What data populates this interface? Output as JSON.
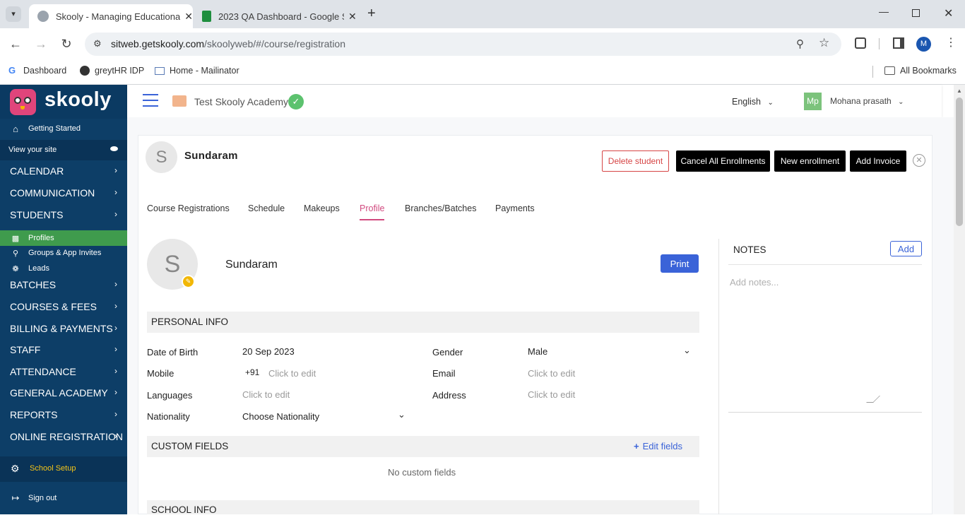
{
  "browser": {
    "tabs": [
      {
        "title": "Skooly - Managing Educational",
        "active": true
      },
      {
        "title": "2023 QA Dashboard - Google S",
        "active": false
      }
    ],
    "url_host": "sitweb.getskooly.com",
    "url_path": "/skoolyweb/#/course/registration",
    "bookmarks": [
      "Dashboard",
      "greytHR IDP",
      "Home - Mailinator"
    ],
    "all_bookmarks": "All Bookmarks",
    "profile_initial": "M"
  },
  "sidebar": {
    "logo_text": "skooly",
    "getting_started": "Getting Started",
    "view_site": "View your site",
    "menu": [
      {
        "label": "CALENDAR"
      },
      {
        "label": "COMMUNICATION"
      },
      {
        "label": "STUDENTS"
      }
    ],
    "students_sub": [
      {
        "label": "Profiles"
      },
      {
        "label": "Groups & App Invites"
      },
      {
        "label": "Leads"
      }
    ],
    "menu2": [
      {
        "label": "BATCHES"
      },
      {
        "label": "COURSES & FEES"
      },
      {
        "label": "BILLING & PAYMENTS"
      },
      {
        "label": "STAFF"
      },
      {
        "label": "ATTENDANCE"
      },
      {
        "label": "GENERAL ACADEMY"
      },
      {
        "label": "REPORTS"
      },
      {
        "label": "ONLINE REGISTRATION"
      }
    ],
    "school_setup": "School Setup",
    "sign_out": "Sign out"
  },
  "header": {
    "school_name": "Test Skooly Academy",
    "language": "English",
    "user_initials": "Mp",
    "user_name": "Mohana prasath"
  },
  "student": {
    "initial": "S",
    "name": "Sundaram"
  },
  "actions": {
    "delete": "Delete student",
    "cancel_all": "Cancel All Enrollments",
    "new_enrollment": "New enrollment",
    "add_invoice": "Add Invoice"
  },
  "tabs": [
    "Course Registrations",
    "Schedule",
    "Makeups",
    "Profile",
    "Branches/Batches",
    "Payments"
  ],
  "active_tab": "Profile",
  "profile": {
    "print": "Print",
    "personal_info": "PERSONAL INFO",
    "dob_label": "Date of Birth",
    "dob_value": "20 Sep 2023",
    "gender_label": "Gender",
    "gender_value": "Male",
    "mobile_label": "Mobile",
    "mobile_code": "+91",
    "mobile_placeholder": "Click to edit",
    "email_label": "Email",
    "email_placeholder": "Click to edit",
    "languages_label": "Languages",
    "languages_placeholder": "Click to edit",
    "address_label": "Address",
    "address_placeholder": "Click to edit",
    "nationality_label": "Nationality",
    "nationality_value": "Choose Nationality",
    "custom_fields": "CUSTOM FIELDS",
    "edit_fields": "Edit fields",
    "no_custom_fields": "No custom fields",
    "school_info": "SCHOOL INFO"
  },
  "notes": {
    "title": "NOTES",
    "add": "Add",
    "placeholder": "Add notes..."
  },
  "colors": {
    "sidebar_bg": "#0d3e67",
    "active_green": "#3f9b4d",
    "accent_pink": "#d14a7f",
    "primary_blue": "#3a63d8"
  }
}
